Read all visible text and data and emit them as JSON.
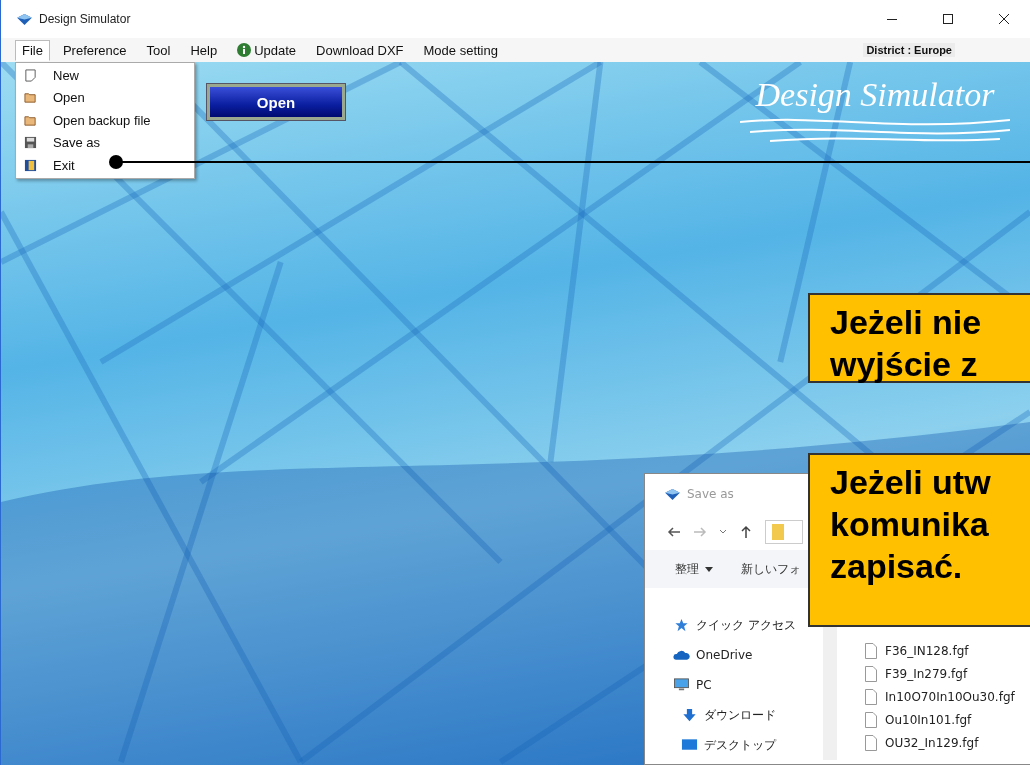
{
  "window": {
    "title": "Design Simulator"
  },
  "menu_bar": {
    "items": [
      {
        "label": "File",
        "kind": "text",
        "selected": true
      },
      {
        "label": "Preference",
        "kind": "text",
        "selected": false
      },
      {
        "label": "Tool",
        "kind": "text",
        "selected": false
      },
      {
        "label": "Help",
        "kind": "text",
        "selected": false
      },
      {
        "label": "Update",
        "kind": "info",
        "selected": false
      },
      {
        "label": "Download DXF",
        "kind": "text",
        "selected": false
      },
      {
        "label": "Mode setting",
        "kind": "text",
        "selected": false
      }
    ],
    "district": "District : Europe"
  },
  "file_menu": {
    "items": [
      "New",
      "Open",
      "Open backup file",
      "Save as",
      "Exit"
    ]
  },
  "open_button": "Open",
  "logo": "Design Simulator",
  "callouts": [
    {
      "lines": [
        "Jeżeli nie",
        "wyjście z"
      ]
    },
    {
      "lines": [
        "Jeżeli utw",
        "komunika",
        "zapisać."
      ]
    }
  ],
  "save_dialog": {
    "title": "Save as",
    "toolbar": [
      "整理",
      "新しいフォ"
    ],
    "nav": [
      "クイック アクセス",
      "OneDrive",
      "PC",
      "ダウンロード",
      "デスクトップ"
    ],
    "files": [
      "F36_IN128.fgf",
      "F39_In279.fgf",
      "In10O70In10Ou30.fgf",
      "Ou10In101.fgf",
      "OU32_In129.fgf"
    ]
  }
}
